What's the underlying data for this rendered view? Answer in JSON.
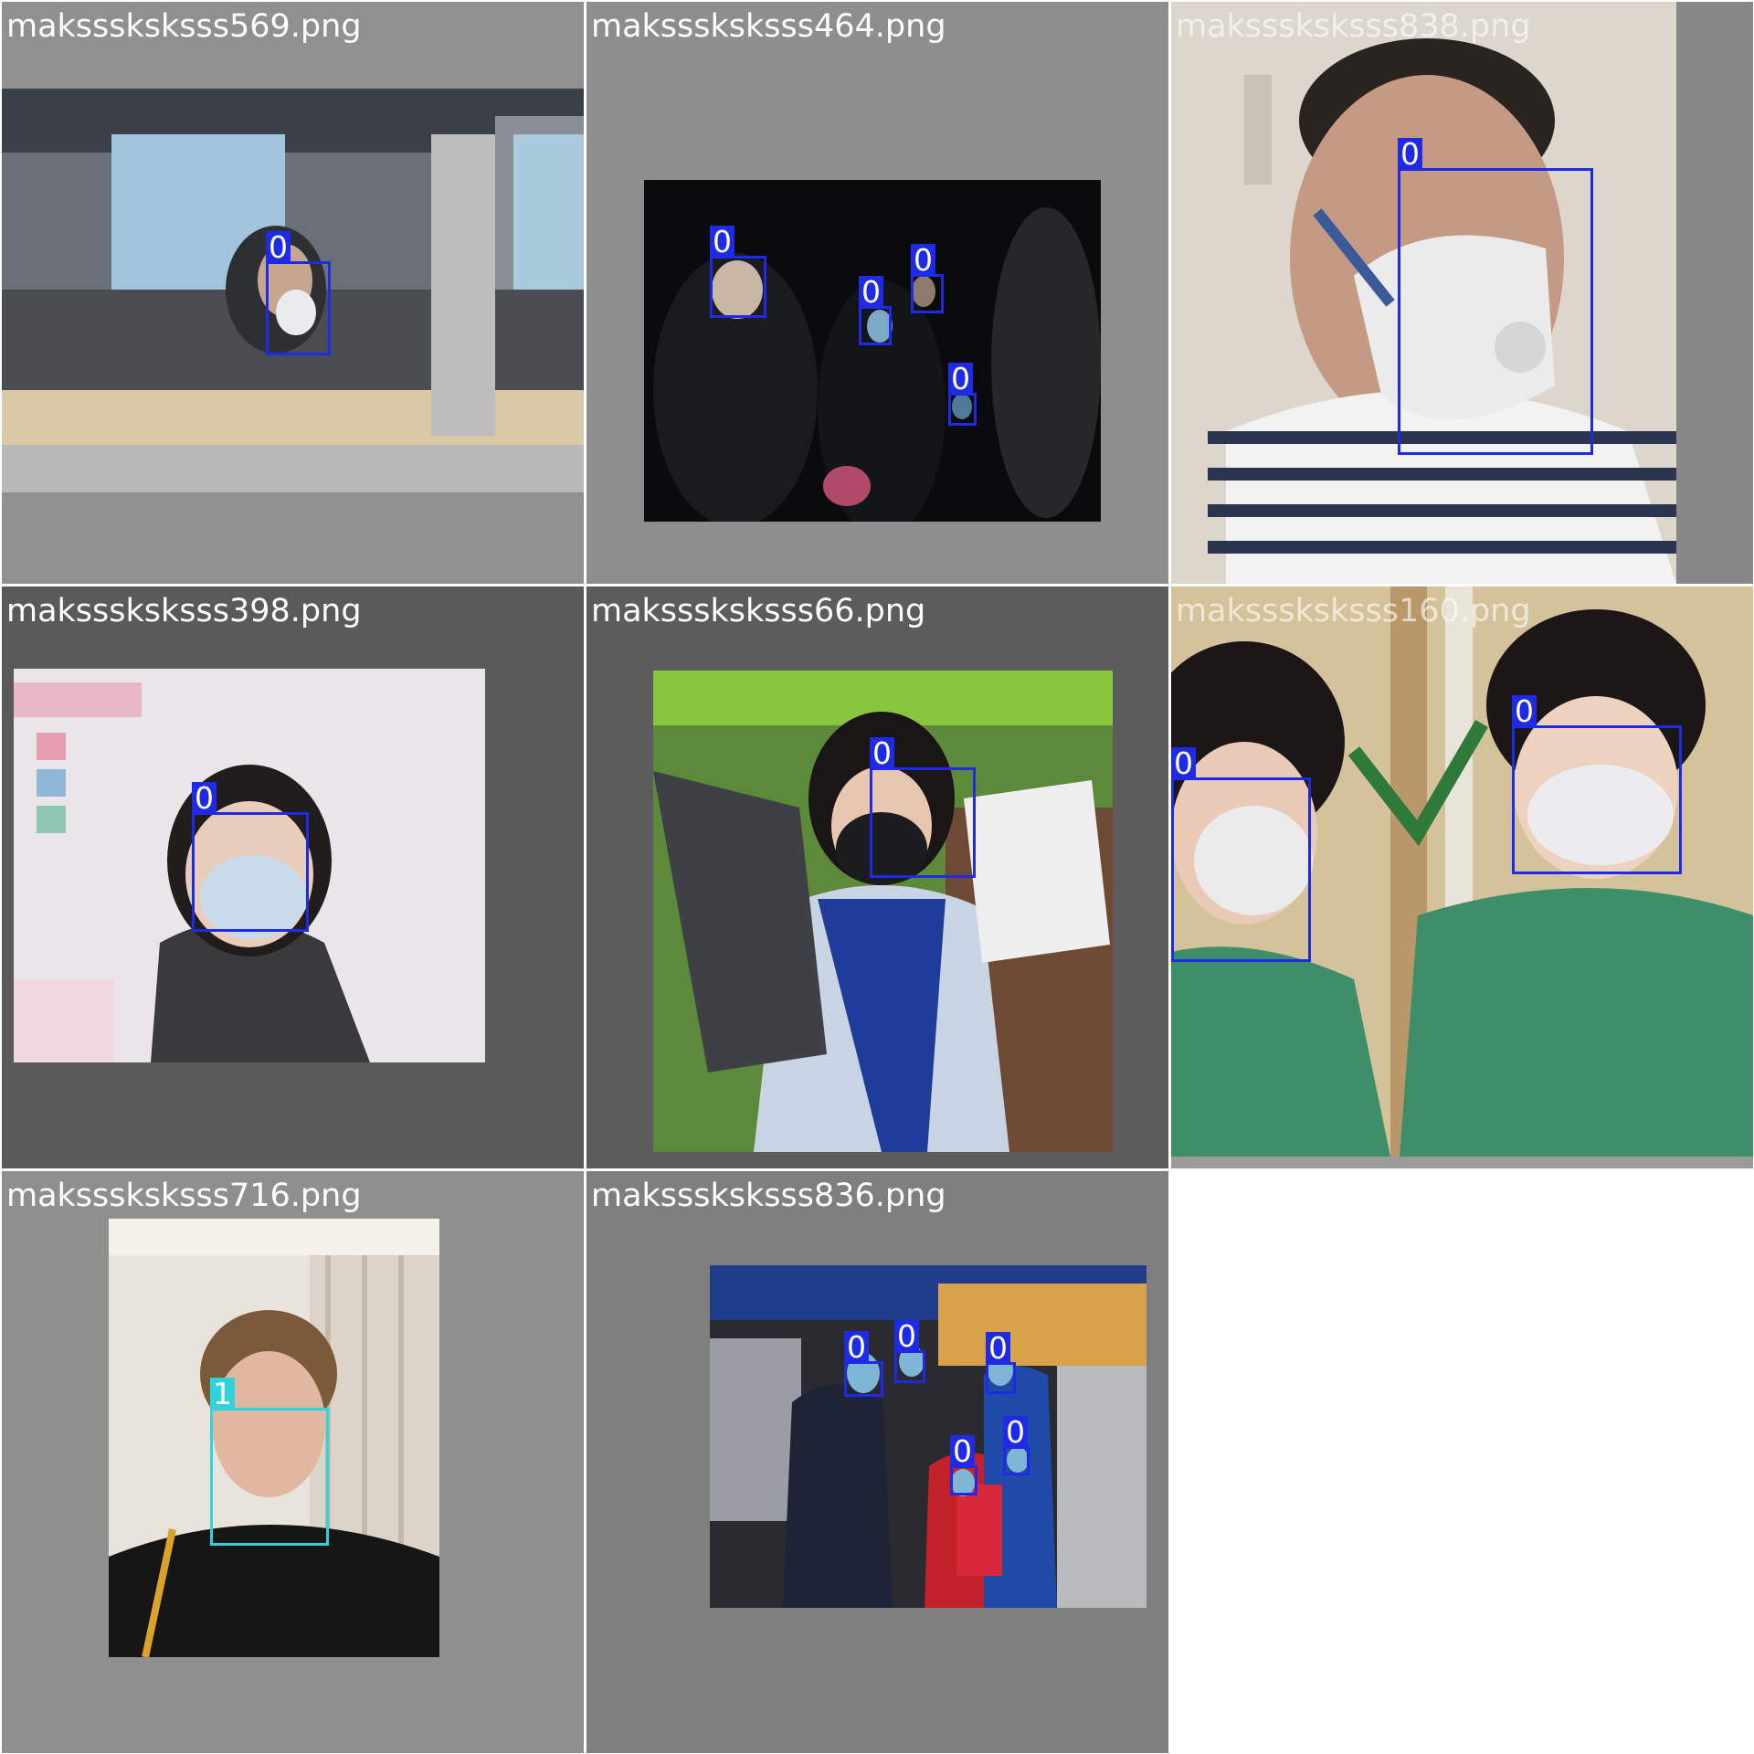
{
  "mosaic": {
    "tiles": [
      {
        "filename": "maksssksksss569.png",
        "background": "#909090",
        "detections": [
          {
            "class_label": "0"
          }
        ]
      },
      {
        "filename": "maksssksksss464.png",
        "background": "#8e8e8e",
        "detections": [
          {
            "class_label": "0"
          },
          {
            "class_label": "0"
          },
          {
            "class_label": "0"
          },
          {
            "class_label": "0"
          }
        ]
      },
      {
        "filename": "maksssksksss838.png",
        "background": "#878787",
        "detections": [
          {
            "class_label": "0"
          }
        ]
      },
      {
        "filename": "maksssksksss398.png",
        "background": "#5a5a5a",
        "detections": [
          {
            "class_label": "0"
          }
        ]
      },
      {
        "filename": "maksssksksss66.png",
        "background": "#5c5c5c",
        "detections": [
          {
            "class_label": "0"
          }
        ]
      },
      {
        "filename": "maksssksksss160.png",
        "background": "#9a9a9a",
        "detections": [
          {
            "class_label": "0"
          },
          {
            "class_label": "0"
          }
        ]
      },
      {
        "filename": "maksssksksss716.png",
        "background": "#8f8f8f",
        "detections": [
          {
            "class_label": "1"
          }
        ]
      },
      {
        "filename": "maksssksksss836.png",
        "background": "#7f7f7f",
        "detections": [
          {
            "class_label": "0"
          },
          {
            "class_label": "0"
          },
          {
            "class_label": "0"
          },
          {
            "class_label": "0"
          },
          {
            "class_label": "0"
          }
        ]
      }
    ],
    "colors": {
      "class_0_box": "#1f2ae6",
      "class_1_box": "#2fd3dc",
      "label_text": "#ffffff"
    }
  }
}
